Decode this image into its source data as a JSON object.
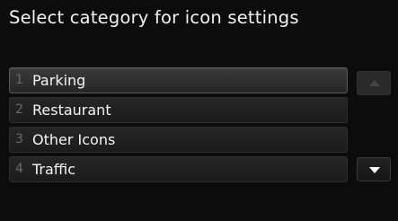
{
  "header": {
    "title": "Select category for icon settings"
  },
  "list": {
    "items": [
      {
        "number": "1",
        "label": "Parking",
        "selected": true
      },
      {
        "number": "2",
        "label": "Restaurant",
        "selected": false
      },
      {
        "number": "3",
        "label": "Other Icons",
        "selected": false
      },
      {
        "number": "4",
        "label": "Traffic",
        "selected": false
      }
    ]
  },
  "scroll": {
    "up_icon": "chevron-up-icon",
    "up_enabled": false,
    "down_icon": "chevron-down-icon",
    "down_enabled": true
  },
  "colors": {
    "background": "#0c0c0c",
    "text": "#f4f4f4",
    "number": "#6a6a6a",
    "disabled_arrow": "#444444"
  }
}
